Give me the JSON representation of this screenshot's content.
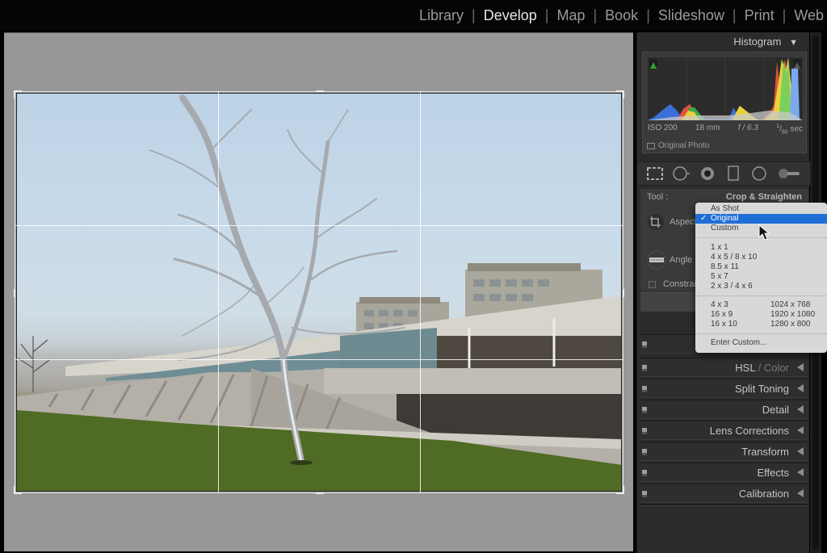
{
  "modules": {
    "items": [
      {
        "label": "Library",
        "active": false
      },
      {
        "label": "Develop",
        "active": true
      },
      {
        "label": "Map",
        "active": false
      },
      {
        "label": "Book",
        "active": false
      },
      {
        "label": "Slideshow",
        "active": false
      },
      {
        "label": "Print",
        "active": false
      },
      {
        "label": "Web",
        "active": false
      }
    ],
    "separator": "|"
  },
  "histogram": {
    "title": "Histogram",
    "collapse_icon": "triangle-down-icon",
    "iso": "ISO 200",
    "focal_length": "18 mm",
    "aperture": "f / 6.3",
    "shutter_num": "1",
    "shutter_den": "80",
    "shutter_unit": "sec",
    "original_photo_label": "Original Photo",
    "shadow_clip_color": "#2fa62f",
    "highlight_clip_color": "#4a4a4a"
  },
  "toolstrip": {
    "tools": [
      {
        "name": "crop-overlay",
        "active": true
      },
      {
        "name": "spot-removal",
        "active": false
      },
      {
        "name": "red-eye",
        "active": false
      },
      {
        "name": "graduated-filter",
        "active": false
      },
      {
        "name": "radial-filter",
        "active": false
      },
      {
        "name": "adjustment-brush",
        "active": false
      }
    ]
  },
  "crop_panel": {
    "tool_label": "Tool :",
    "tool_name": "Crop & Straighten",
    "aspect_label": "Aspect",
    "angle_label": "Angle",
    "constrain_label": "Constrain"
  },
  "aspect_menu": {
    "selected": "Original",
    "group1": [
      "As Shot",
      "Original",
      "Custom"
    ],
    "group2": [
      "1 x 1",
      "4 x 5  /  8 x 10",
      "8.5 x 11",
      "5 x 7",
      "2 x 3  /  4 x 6"
    ],
    "group3": [
      {
        "ratio": "4 x 3",
        "size": "1024 x 768"
      },
      {
        "ratio": "16 x 9",
        "size": "1920 x 1080"
      },
      {
        "ratio": "16 x 10",
        "size": "1280 x 800"
      }
    ],
    "group4": [
      "Enter Custom..."
    ],
    "checkmark": "✓",
    "highlight_color": "#1f6ed6"
  },
  "panels": [
    {
      "title": "HSL",
      "subtitle": "Color",
      "separator": " / "
    },
    {
      "title": "Split Toning"
    },
    {
      "title": "Detail"
    },
    {
      "title": "Lens Corrections"
    },
    {
      "title": "Transform"
    },
    {
      "title": "Effects"
    },
    {
      "title": "Calibration"
    }
  ],
  "crop_overlay": {
    "grid": "thirds"
  }
}
